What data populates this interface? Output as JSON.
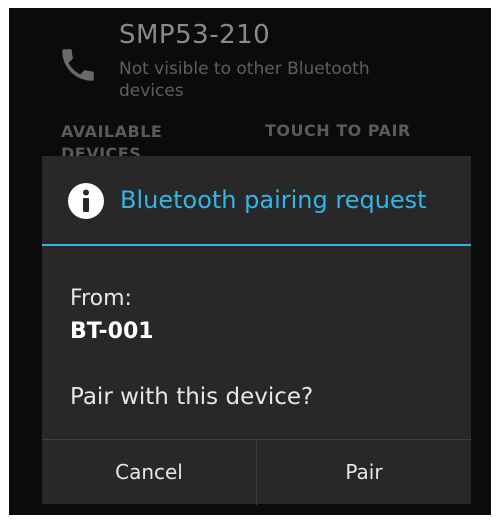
{
  "background_screen": {
    "device_name": "SMP53-210",
    "device_status": "Not visible to other Bluetooth devices",
    "section_available": "AVAILABLE DEVICES",
    "section_touch": "TOUCH TO PAIR",
    "icon": "phone-icon"
  },
  "dialog": {
    "icon": "info-icon",
    "title": "Bluetooth pairing request",
    "from_label": "From:",
    "from_device": "BT-001",
    "question": "Pair with this device?",
    "buttons": {
      "cancel": "Cancel",
      "pair": "Pair"
    }
  },
  "colors": {
    "accent": "#33b5e5",
    "dialog_bg": "#282828",
    "screen_bg": "#0b0b0b"
  }
}
